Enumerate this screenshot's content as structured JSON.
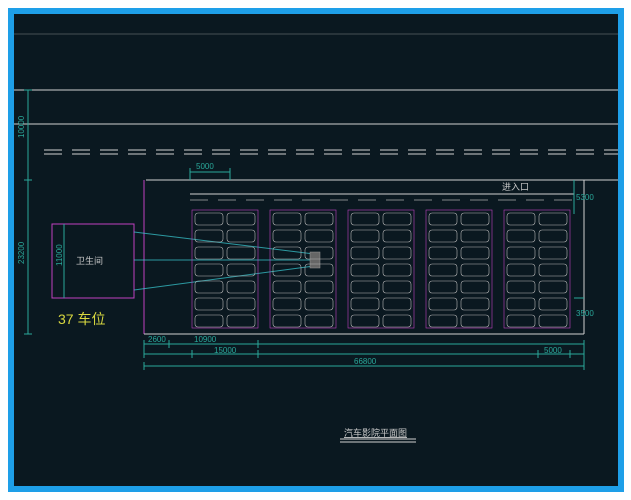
{
  "title": "汽车影院平面图",
  "parking_count_label": "37 车位",
  "room_label": "卫生间",
  "entrance_label": "进入口",
  "dimensions": {
    "height_total": "23200",
    "height_upper": "10000",
    "height_room": "11000",
    "col_spacing": "5000",
    "slot_depth": "2600",
    "slot_width": "10900",
    "row_span": "15000",
    "width_total": "66800",
    "aisle_right": "5300",
    "row_gap": "3500",
    "gap_end": "5000"
  },
  "chart_data": {
    "type": "diagram",
    "description": "CAD parking lot floor plan",
    "parking_spaces": 37,
    "columns": 5,
    "rows_per_column": 7,
    "cars_per_row": 2,
    "features": [
      "卫生间 (restroom)",
      "进入口 (entrance)",
      "road lanes"
    ],
    "overall_width": 66800,
    "overall_height": 23200,
    "upper_road_band": 10000,
    "restroom_height": 11000,
    "slot_depth": 2600,
    "slot_pair_width": 10900,
    "column_spacing": 5000,
    "aisle_right": 5300,
    "row_gap": 3500
  }
}
